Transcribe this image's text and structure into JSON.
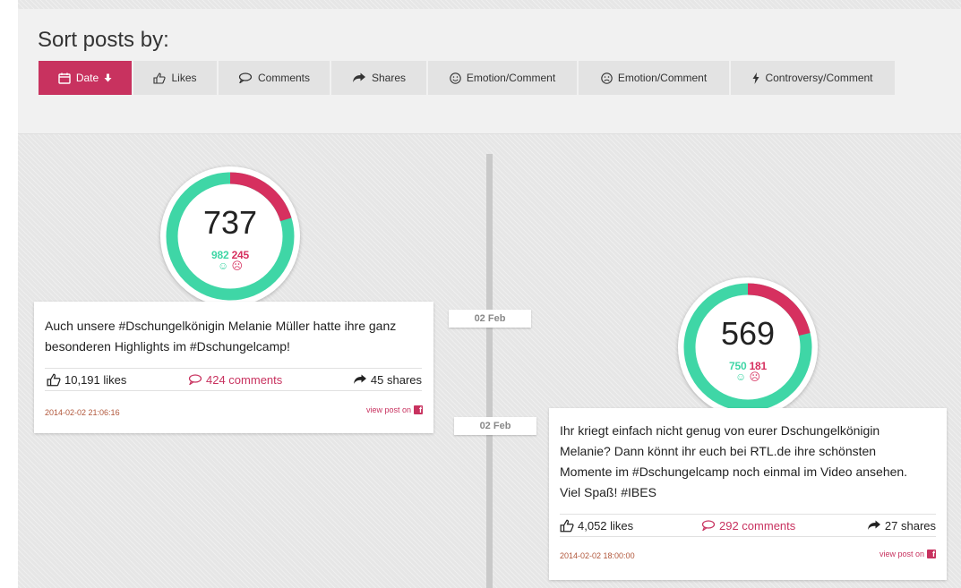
{
  "header": {
    "title": "Sort posts by:",
    "sort_options": [
      {
        "label": "Date",
        "icon": "calendar-icon",
        "active": true,
        "indicator": "arrow-down-icon"
      },
      {
        "label": "Likes",
        "icon": "thumbs-up-icon",
        "active": false
      },
      {
        "label": "Comments",
        "icon": "comment-icon",
        "active": false
      },
      {
        "label": "Shares",
        "icon": "share-arrow-icon",
        "active": false
      },
      {
        "label": "Emotion/Comment",
        "icon": "smile-icon",
        "active": false
      },
      {
        "label": "Emotion/Comment",
        "icon": "frown-icon",
        "active": false
      },
      {
        "label": "Controversy/Comment",
        "icon": "lightning-icon",
        "active": false
      }
    ]
  },
  "colors": {
    "accent": "#c8325f",
    "positive": "#3fd6a6",
    "negative": "#d6305f",
    "date_text": "#b1573b"
  },
  "posts": [
    {
      "score": "737",
      "positive": "982",
      "negative": "245",
      "text_lines": [
        "Auch unsere #Dschungelkönigin Melanie Müller hatte ihre ganz",
        "besonderen Highlights im #Dschungelcamp!"
      ],
      "likes": "10,191 likes",
      "comments": "424 comments",
      "shares": "45 shares",
      "timestamp": "2014-02-02 21:06:16",
      "view_label": "view post on",
      "date_tag": "02 Feb"
    },
    {
      "score": "569",
      "positive": "750",
      "negative": "181",
      "text_lines": [
        "Ihr kriegt einfach nicht genug von eurer Dschungelkönigin",
        "Melanie? Dann könnt ihr euch bei RTL.de ihre schönsten",
        "Momente im #Dschungelcamp noch einmal im Video ansehen.",
        "Viel Spaß! #IBES"
      ],
      "likes": "4,052 likes",
      "comments": "292 comments",
      "shares": "27 shares",
      "timestamp": "2014-02-02 18:00:00",
      "view_label": "view post on",
      "date_tag": "02 Feb"
    }
  ]
}
